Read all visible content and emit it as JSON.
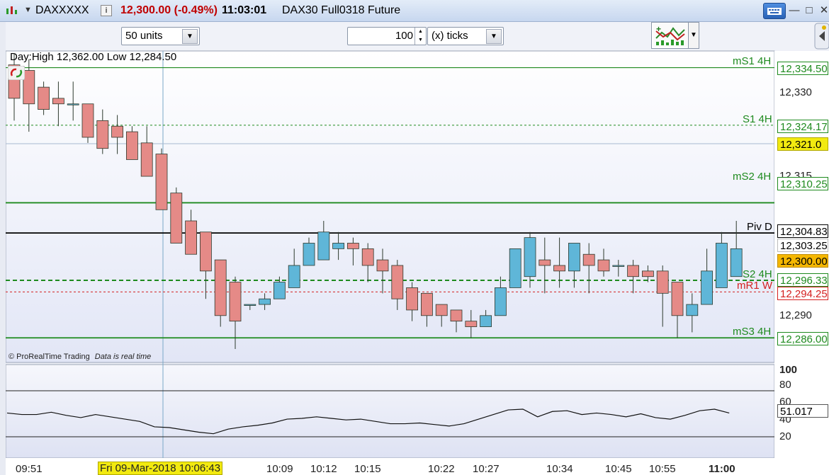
{
  "titlebar": {
    "symbol": "DAXXXXX",
    "price_change": "12,300.00 (-0.49%)",
    "time": "11:03:01",
    "description": "DAX30 Full0318 Future",
    "info_icon": "i",
    "menu_arrow": "▼",
    "minimize": "—",
    "maximize": "□",
    "close": "✕"
  },
  "toolbar": {
    "units_select": "50 units",
    "ticks_value": "100",
    "ticks_select": "(x) ticks"
  },
  "chart_header": "Day:High 12,362.00 Low 12,284.50",
  "credit": {
    "brand": "© ProRealTime Trading",
    "status": "Data is real time"
  },
  "price_levels": [
    {
      "label": "mS1 4H",
      "value": "12,334.50",
      "color": "#1e8a1e"
    },
    {
      "label": "S1 4H",
      "value": "12,324.17",
      "color": "#1e8a1e"
    },
    {
      "label": "",
      "value": "12,321.0",
      "color": "#e8e000"
    },
    {
      "label": "mS2 4H",
      "value": "12,310.25",
      "color": "#1e8a1e"
    },
    {
      "label": "Piv D",
      "value": "12,304.83",
      "color": "#000000"
    },
    {
      "label": "",
      "value": "12,303.25",
      "color": "#000000"
    },
    {
      "label": "",
      "value": "12,300.00",
      "color": "#f5b700"
    },
    {
      "label": "S2 4H",
      "value": "12,296.33",
      "color": "#1e8a1e"
    },
    {
      "label": "mR1 W",
      "value": "12,294.25",
      "color": "#d42020"
    },
    {
      "label": "mS3 4H",
      "value": "12,286.00",
      "color": "#1e8a1e"
    }
  ],
  "y_ticks": [
    "12,330",
    "12,315",
    "12,290"
  ],
  "osc_ticks": [
    "100",
    "80",
    "60",
    "40",
    "20"
  ],
  "osc_value": "51.017",
  "x_labels": [
    "09:51",
    "Fri 09-Mar-2018 10:06:43",
    "10:09",
    "10:12",
    "10:15",
    "10:22",
    "10:27",
    "10:34",
    "10:45",
    "10:55",
    "11:00"
  ],
  "colors": {
    "bull": "#5fb6d8",
    "bear": "#e58a87",
    "bg": "#eef0f9"
  },
  "chart_data": {
    "type": "candlestick",
    "candles": [
      {
        "o": 12335,
        "h": 12337,
        "l": 12325,
        "c": 12329
      },
      {
        "o": 12334,
        "h": 12336,
        "l": 12323,
        "c": 12328
      },
      {
        "o": 12331,
        "h": 12332,
        "l": 12326,
        "c": 12327
      },
      {
        "o": 12329,
        "h": 12332,
        "l": 12324,
        "c": 12328
      },
      {
        "o": 12328,
        "h": 12332,
        "l": 12325,
        "c": 12328
      },
      {
        "o": 12328,
        "h": 12328,
        "l": 12321,
        "c": 12322
      },
      {
        "o": 12325,
        "h": 12327,
        "l": 12319,
        "c": 12320
      },
      {
        "o": 12324,
        "h": 12326,
        "l": 12319,
        "c": 12322
      },
      {
        "o": 12323,
        "h": 12324,
        "l": 12318,
        "c": 12318
      },
      {
        "o": 12321,
        "h": 12324,
        "l": 12315,
        "c": 12315
      },
      {
        "o": 12319,
        "h": 12320,
        "l": 12309,
        "c": 12309
      },
      {
        "o": 12312,
        "h": 12313,
        "l": 12303,
        "c": 12303
      },
      {
        "o": 12307,
        "h": 12309,
        "l": 12301,
        "c": 12301
      },
      {
        "o": 12305,
        "h": 12305,
        "l": 12293,
        "c": 12298
      },
      {
        "o": 12300,
        "h": 12300,
        "l": 12288,
        "c": 12290
      },
      {
        "o": 12296,
        "h": 12297,
        "l": 12284,
        "c": 12289
      },
      {
        "o": 12292,
        "h": 12292,
        "l": 12291,
        "c": 12292
      },
      {
        "o": 12292,
        "h": 12294,
        "l": 12291,
        "c": 12293
      },
      {
        "o": 12293,
        "h": 12297,
        "l": 12293,
        "c": 12296
      },
      {
        "o": 12295,
        "h": 12302,
        "l": 12295,
        "c": 12299
      },
      {
        "o": 12299,
        "h": 12304,
        "l": 12299,
        "c": 12303
      },
      {
        "o": 12300,
        "h": 12307,
        "l": 12300,
        "c": 12305
      },
      {
        "o": 12302,
        "h": 12305,
        "l": 12300,
        "c": 12303
      },
      {
        "o": 12303,
        "h": 12304,
        "l": 12299,
        "c": 12302
      },
      {
        "o": 12302,
        "h": 12303,
        "l": 12296,
        "c": 12299
      },
      {
        "o": 12300,
        "h": 12302,
        "l": 12294,
        "c": 12298
      },
      {
        "o": 12299,
        "h": 12300,
        "l": 12291,
        "c": 12293
      },
      {
        "o": 12295,
        "h": 12296,
        "l": 12289,
        "c": 12291
      },
      {
        "o": 12294,
        "h": 12294,
        "l": 12288,
        "c": 12290
      },
      {
        "o": 12292,
        "h": 12292,
        "l": 12288,
        "c": 12290
      },
      {
        "o": 12291,
        "h": 12291,
        "l": 12287,
        "c": 12289
      },
      {
        "o": 12289,
        "h": 12291,
        "l": 12286,
        "c": 12288
      },
      {
        "o": 12288,
        "h": 12291,
        "l": 12288,
        "c": 12290
      },
      {
        "o": 12290,
        "h": 12297,
        "l": 12290,
        "c": 12295
      },
      {
        "o": 12295,
        "h": 12302,
        "l": 12295,
        "c": 12302
      },
      {
        "o": 12297,
        "h": 12305,
        "l": 12295,
        "c": 12304
      },
      {
        "o": 12300,
        "h": 12304,
        "l": 12294,
        "c": 12299
      },
      {
        "o": 12299,
        "h": 12304,
        "l": 12295,
        "c": 12298
      },
      {
        "o": 12298,
        "h": 12303,
        "l": 12295,
        "c": 12303
      },
      {
        "o": 12301,
        "h": 12303,
        "l": 12294,
        "c": 12299
      },
      {
        "o": 12300,
        "h": 12302,
        "l": 12297,
        "c": 12298
      },
      {
        "o": 12299,
        "h": 12300,
        "l": 12297,
        "c": 12299
      },
      {
        "o": 12299,
        "h": 12300,
        "l": 12294,
        "c": 12297
      },
      {
        "o": 12298,
        "h": 12299,
        "l": 12296,
        "c": 12297
      },
      {
        "o": 12298,
        "h": 12299,
        "l": 12288,
        "c": 12294
      },
      {
        "o": 12296,
        "h": 12296,
        "l": 12286,
        "c": 12290
      },
      {
        "o": 12290,
        "h": 12294,
        "l": 12287,
        "c": 12292
      },
      {
        "o": 12292,
        "h": 12302,
        "l": 12292,
        "c": 12298
      },
      {
        "o": 12295,
        "h": 12305,
        "l": 12295,
        "c": 12303
      },
      {
        "o": 12297,
        "h": 12307,
        "l": 12297,
        "c": 12302
      }
    ],
    "oscillator": [
      51,
      49,
      49,
      52,
      48,
      45,
      49,
      46,
      43,
      40,
      33,
      32,
      29,
      26,
      24,
      30,
      33,
      35,
      38,
      43,
      44,
      46,
      44,
      42,
      43,
      40,
      37,
      37,
      38,
      36,
      34,
      37,
      43,
      49,
      55,
      56,
      46,
      53,
      54,
      49,
      51,
      49,
      46,
      50,
      45,
      43,
      48,
      54,
      56,
      51
    ],
    "osc_levels": [
      80,
      20
    ]
  }
}
